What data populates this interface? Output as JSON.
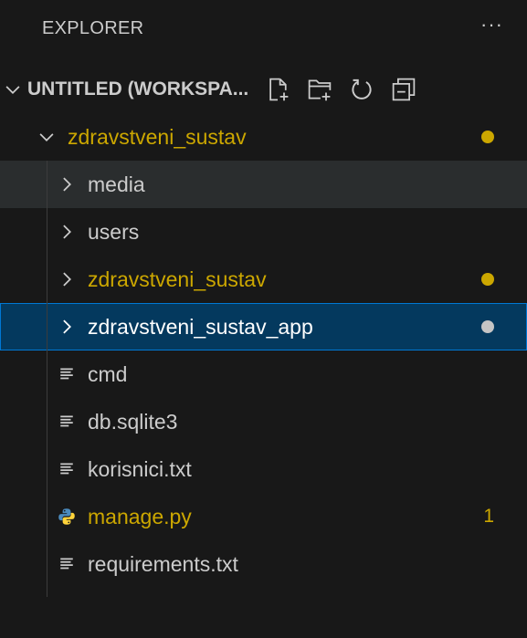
{
  "explorer": {
    "title": "EXPLORER",
    "more_actions": "···"
  },
  "workspace": {
    "title": "UNTITLED (WORKSPA...",
    "actions": [
      "new-file-icon",
      "new-folder-icon",
      "refresh-icon",
      "collapse-all-icon"
    ]
  },
  "tree": {
    "root": {
      "label": "zdravstveni_sustav",
      "decoration_color": "#cca700"
    },
    "items": [
      {
        "label": "media",
        "type": "folder"
      },
      {
        "label": "users",
        "type": "folder"
      },
      {
        "label": "zdravstveni_sustav",
        "type": "folder",
        "decoration_color": "#cca700"
      },
      {
        "label": "zdravstveni_sustav_app",
        "type": "folder",
        "decoration_color": "#c5c5c5"
      },
      {
        "label": "cmd",
        "type": "file"
      },
      {
        "label": "db.sqlite3",
        "type": "file"
      },
      {
        "label": "korisnici.txt",
        "type": "file"
      },
      {
        "label": "manage.py",
        "type": "python",
        "badge": "1"
      },
      {
        "label": "requirements.txt",
        "type": "file"
      }
    ]
  },
  "colors": {
    "background": "#181818",
    "modified": "#cca700",
    "selection": "#04395e",
    "focus_border": "#0078d4",
    "hover": "#2a2d2e"
  }
}
